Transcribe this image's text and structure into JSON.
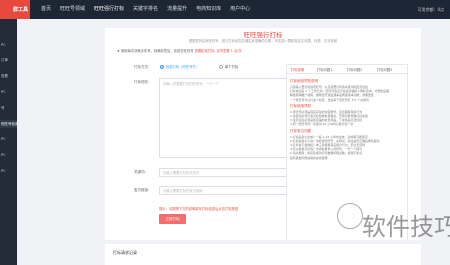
{
  "header": {
    "logo": "群工具",
    "nav": [
      "首页",
      "旺旺号领域",
      "旺旺强行打标",
      "关键字排名",
      "流量提升",
      "电商知识库",
      "用户中心"
    ],
    "user": "可用余额：0点"
  },
  "sidebar": {
    "items": [
      "PC",
      "订单",
      "查看",
      "PC",
      "号",
      "旺旺号检测",
      "PC",
      "PC",
      "PC"
    ]
  },
  "page": {
    "title": "旺旺强行打标",
    "subtitle": "根据您的买家旺旺号、强行打标给您店铺买家准确的位置，可实现人群精准定位效果、标签、引流有助",
    "notice_prefix": "★ 使用每次消耗手机号、精确标签店、收费在旺旺号 ",
    "notice_warn": "查看精准打标: 实时查看 1 点/次"
  },
  "form": {
    "type_label": "打标方式:",
    "type_options": [
      "批量打标（旺旺号打）",
      "单个打标"
    ],
    "wangwang_label": "打标旺旺:",
    "wangwang_placeholder": "请输入您需要打标的旺旺号，一行一个",
    "keyword_label": "关键词:",
    "keyword_placeholder": "请输入需要打标的关键词",
    "link_label": "宝贝链接:",
    "link_placeholder": "请输入需要打标的宝贝链接",
    "tip": "提示：请按照下方的说明填写打标信息后点击打标按钮",
    "submit": "立即打标"
  },
  "panel": {
    "tabs": [
      "打标说明",
      "打标问题1",
      "打标问题2",
      "打标问题3"
    ],
    "sections": [
      {
        "title": "打标使用须知说明",
        "lines": [
          "只需输入要打标的旺旺号，以及需要打标的关键词和宝贝链接",
          "打标成功后 1 个工作日内，旺旺号会显示在您店铺的人群标签中，方便您后期",
          "精准营销推广使用，推荐您开通直通车后再使用本功能，效果更佳",
          "一个旺旺号可以打多个标签，建议每个旺旺号打 3-5 个关键词"
        ]
      },
      {
        "title": "打标使用须知",
        "lines": [
          "1.旺旺号必须是真实存在的淘宝账号，且近期有购买行为",
          "2.关键词必须与宝贝标题或类目相关，否则可能导致打标失败",
          "3.宝贝链接必须是您店铺的在售商品，下架商品无法打标",
          "4.同一旺旺号同一关键词 24 小时内只能打标一次"
        ]
      },
      {
        "title": "打标常见问题",
        "lines": [
          "1.打标后多久生效？一般 1-24 小时内生效，高峰期可能延迟",
          "2.打标失败怎么办？请检查旺旺号、关键词、链接是否正确后重新提交",
          "3.打标会不会降权？本工具模拟真实用户行为，安全无风险",
          "4.可以批量打标吗？支持批量导入旺旺号，一行一个即可",
          "5.扣点规则：按实际成功打标数量扣除点数，失败不扣点",
          "如有其他问题请联系在线客服"
        ]
      }
    ]
  },
  "records": {
    "title": "打标请求记录"
  },
  "watermark": "软件技巧"
}
